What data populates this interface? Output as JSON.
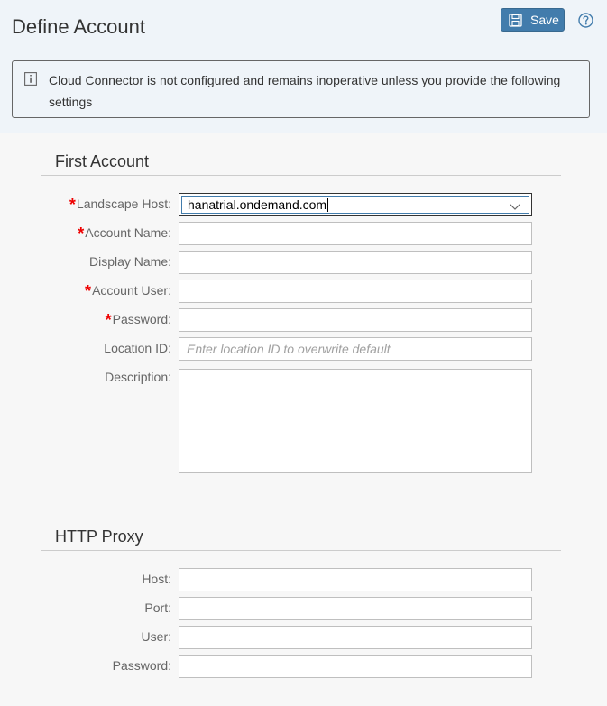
{
  "header": {
    "title": "Define Account",
    "save_label": "Save"
  },
  "message": {
    "text": "Cloud Connector is not configured and remains inoperative unless you provide the following settings"
  },
  "first_account": {
    "title": "First Account",
    "landscape_host": {
      "label": "Landscape Host:",
      "value": "hanatrial.ondemand.com"
    },
    "account_name": {
      "label": "Account Name:",
      "value": ""
    },
    "display_name": {
      "label": "Display Name:",
      "value": ""
    },
    "account_user": {
      "label": "Account User:",
      "value": ""
    },
    "password": {
      "label": "Password:",
      "value": ""
    },
    "location_id": {
      "label": "Location ID:",
      "value": "",
      "placeholder": "Enter location ID to overwrite default"
    },
    "description": {
      "label": "Description:",
      "value": ""
    }
  },
  "http_proxy": {
    "title": "HTTP Proxy",
    "host": {
      "label": "Host:",
      "value": ""
    },
    "port": {
      "label": "Port:",
      "value": ""
    },
    "user": {
      "label": "User:",
      "value": ""
    },
    "password": {
      "label": "Password:",
      "value": ""
    }
  },
  "required_marker": "*",
  "colors": {
    "accent": "#427cac",
    "required": "#e00000",
    "header_bg": "#eff4f9"
  }
}
